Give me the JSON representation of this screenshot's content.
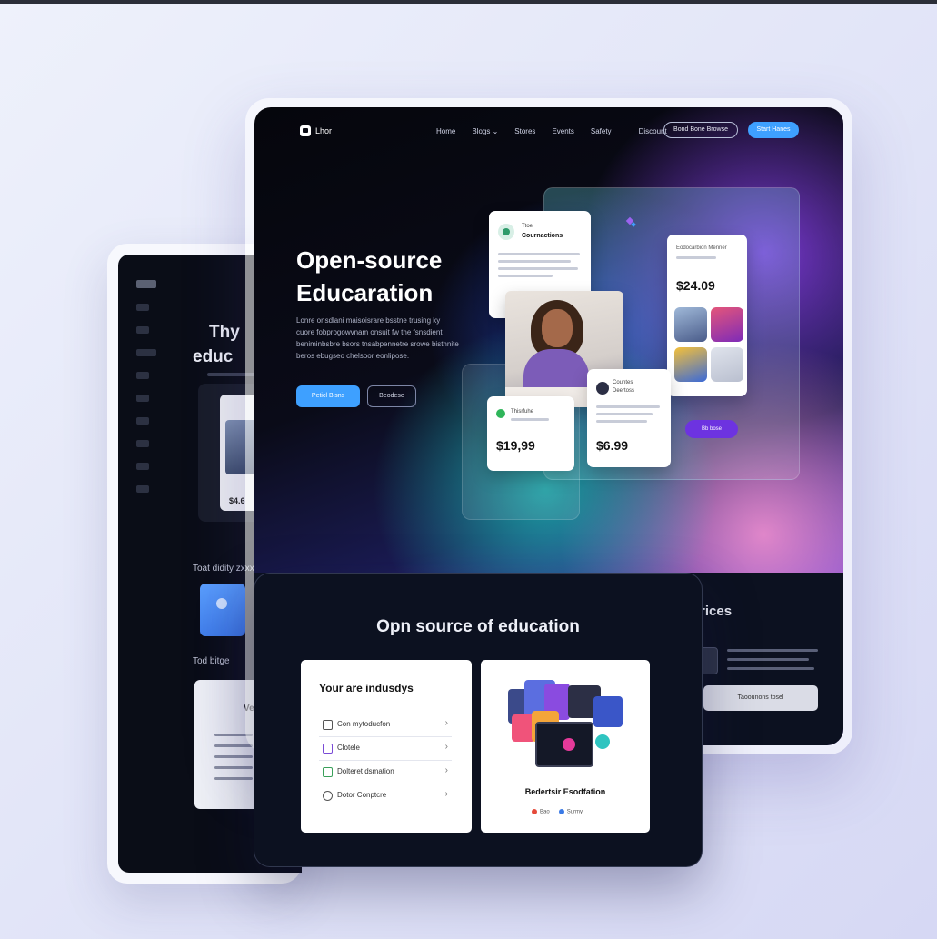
{
  "nav": {
    "brand": "Lhor",
    "links": [
      "Home",
      "Blogs ⌄",
      "Stores",
      "Events",
      "Safety",
      "Discount"
    ],
    "outline_btn": "Bond Bone Browse",
    "cta_btn": "Start Hanes"
  },
  "hero": {
    "title_line1": "Open-source",
    "title_line2": "Educaration",
    "description": "Lonre onsdlani maisoisrare bsstne trusing ky cuore fobprogowvnam onsuit fw the fsnsdient beniminbsbre bsors tnsabpennetre srowe bisthnite beros ebugseo chelsoor eonlipose.",
    "primary_btn": "Peticl Bisns",
    "secondary_btn": "Beodese"
  },
  "cards": {
    "course_card": {
      "label": "Ttoe",
      "title": "Cournactions"
    },
    "pricing_card": {
      "label": "Eodocarbion Menner",
      "price": "$24.09"
    },
    "price_small": {
      "label": "Thisrfuhe",
      "price": "$19,99"
    },
    "tutor_card": {
      "line1": "Countes",
      "line2": "Deertoss",
      "price": "$6.99"
    },
    "join_btn": "Bb bose"
  },
  "services": {
    "title": "rices",
    "button": "Taoounons tosel"
  },
  "back_panel": {
    "title_line1": "Thy",
    "title_line2": "educ",
    "card_price": "$4.6",
    "label1": "Toat didity zxxx",
    "label2": "Tod bitge",
    "list_heading": "Ve"
  },
  "front": {
    "title": "Opn source of education",
    "industry_title": "Your are indusdys",
    "items": [
      {
        "label": "Con mytoducfon",
        "chevron": "›"
      },
      {
        "label": "Clotele",
        "chevron": "›"
      },
      {
        "label": "Dolteret dsmation",
        "chevron": "›"
      },
      {
        "label": "Dotor Conptcre",
        "chevron": "›"
      }
    ],
    "image_caption": "Bedertsir Esodfation",
    "foot1": "Bao",
    "foot2": "Surmy"
  },
  "colors": {
    "accent_blue": "#3ea0ff",
    "accent_purple": "#6d33e0",
    "panel_dark": "#0c1120"
  }
}
